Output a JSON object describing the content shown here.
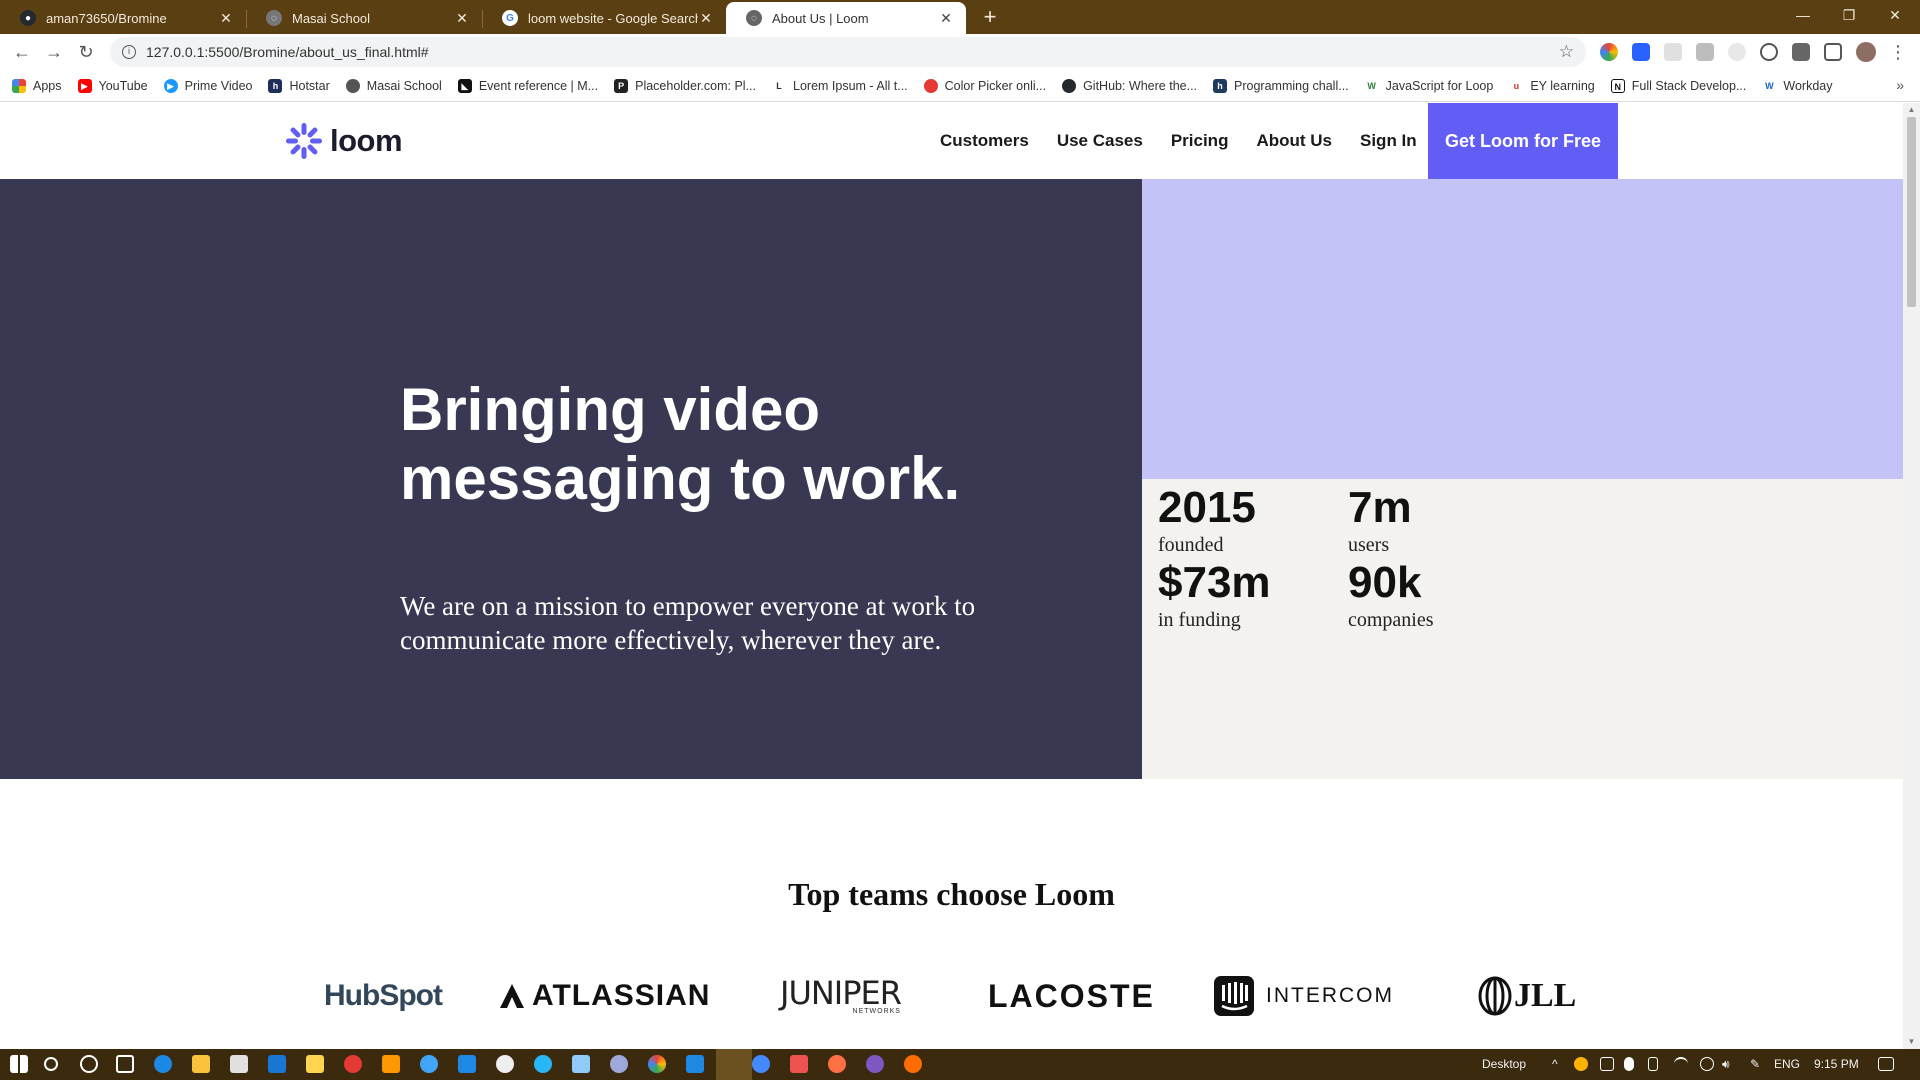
{
  "browser": {
    "tabs": [
      {
        "title": "aman73650/Bromine",
        "icon": "github-icon"
      },
      {
        "title": "Masai School",
        "icon": "globe-icon"
      },
      {
        "title": "loom website - Google Search",
        "icon": "google-icon"
      },
      {
        "title": "About Us | Loom",
        "icon": "globe-icon",
        "active": true
      }
    ],
    "new_tab": "+",
    "url": "127.0.0.1:5500/Bromine/about_us_final.html#",
    "bookmarks": [
      {
        "label": "Apps",
        "icon": "apps-grid-icon",
        "color": "#ea4335"
      },
      {
        "label": "YouTube",
        "icon": "youtube-icon",
        "color": "#ff0000"
      },
      {
        "label": "Prime Video",
        "icon": "prime-video-icon",
        "color": "#1a98ff"
      },
      {
        "label": "Hotstar",
        "icon": "hotstar-icon",
        "color": "#1f2d5a"
      },
      {
        "label": "Masai School",
        "icon": "globe-icon",
        "color": "#555555"
      },
      {
        "label": "Event reference | M...",
        "icon": "mdn-icon",
        "color": "#111111"
      },
      {
        "label": "Placeholder.com: Pl...",
        "icon": "placeholder-icon",
        "color": "#222222"
      },
      {
        "label": "Lorem Ipsum - All t...",
        "icon": "lorem-icon",
        "color": "#333333"
      },
      {
        "label": "Color Picker onli...",
        "icon": "color-picker-icon",
        "color": "#e53935"
      },
      {
        "label": "GitHub: Where the...",
        "icon": "github-icon",
        "color": "#24292e"
      },
      {
        "label": "Programming chall...",
        "icon": "hackerrank-icon",
        "color": "#1f3a5f"
      },
      {
        "label": "JavaScript for Loop",
        "icon": "w3schools-icon",
        "color": "#2e7d32"
      },
      {
        "label": "EY learning",
        "icon": "ey-icon",
        "color": "#d32f2f"
      },
      {
        "label": "Full Stack Develop...",
        "icon": "notion-icon",
        "color": "#111111"
      },
      {
        "label": "Workday",
        "icon": "workday-icon",
        "color": "#f5a623"
      }
    ]
  },
  "site": {
    "logo_text": "loom",
    "brand_color": "#625df5",
    "nav": [
      "Customers",
      "Use Cases",
      "Pricing",
      "About Us",
      "Sign In"
    ],
    "cta": "Get Loom for Free"
  },
  "hero": {
    "title": "Bringing video messaging to work.",
    "subtitle": "We are on a mission to empower everyone at work to communicate more effectively, wherever they are.",
    "colors": {
      "dark": "#383853",
      "lavender": "#c4c3f7",
      "cream": "#f4f2ee"
    },
    "stats": [
      {
        "value": "2015",
        "label": "founded"
      },
      {
        "value": "7m",
        "label": "users"
      },
      {
        "value": "$73m",
        "label": "in funding"
      },
      {
        "value": "90k",
        "label": "companies"
      }
    ]
  },
  "customers": {
    "title": "Top teams choose Loom",
    "logos": [
      "HubSpot",
      "ATLASSIAN",
      "JUNIPER",
      "NETWORKS",
      "LACOSTE",
      "INTERCOM",
      "JLL"
    ]
  },
  "taskbar": {
    "desktop_label": "Desktop",
    "language": "ENG",
    "time": "9:15 PM"
  }
}
